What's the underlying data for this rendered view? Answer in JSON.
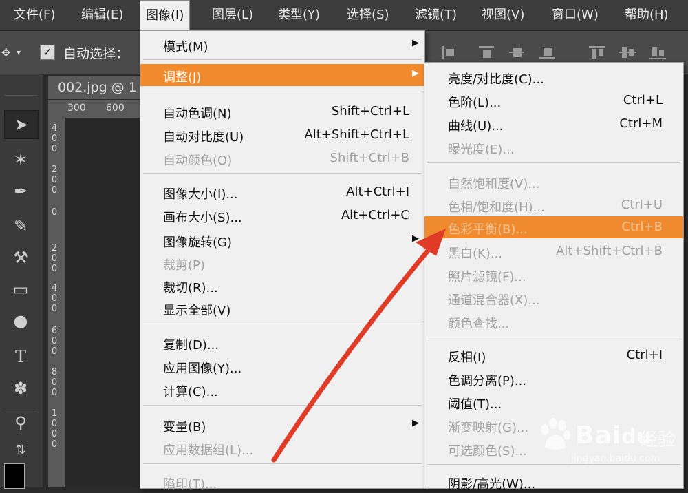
{
  "menubar": {
    "items": [
      "文件(F)",
      "编辑(E)",
      "图像(I)",
      "图层(L)",
      "类型(Y)",
      "选择(S)",
      "滤镜(T)",
      "视图(V)",
      "窗口(W)",
      "帮助(H)"
    ]
  },
  "options": {
    "auto_select_label": "自动选择："
  },
  "document": {
    "tab_title": "002.jpg @ 1",
    "ruler_h": [
      "300",
      "600"
    ],
    "ruler_v": [
      "4",
      "0",
      "0",
      "2",
      "0",
      "0",
      "0",
      "2",
      "0",
      "0",
      "4",
      "0",
      "0",
      "6",
      "0",
      "0",
      "8",
      "0",
      "0",
      "1",
      "0",
      "0",
      "0"
    ]
  },
  "image_menu": {
    "items": [
      {
        "label": "模式(M)",
        "shortcut": "",
        "submenu": true,
        "state": "normal"
      },
      {
        "label": "调整(J)",
        "shortcut": "",
        "submenu": true,
        "state": "highlight"
      },
      {
        "label": "自动色调(N)",
        "shortcut": "Shift+Ctrl+L",
        "submenu": false,
        "state": "normal"
      },
      {
        "label": "自动对比度(U)",
        "shortcut": "Alt+Shift+Ctrl+L",
        "submenu": false,
        "state": "normal"
      },
      {
        "label": "自动颜色(O)",
        "shortcut": "Shift+Ctrl+B",
        "submenu": false,
        "state": "disabled"
      },
      {
        "label": "图像大小(I)...",
        "shortcut": "Alt+Ctrl+I",
        "submenu": false,
        "state": "normal"
      },
      {
        "label": "画布大小(S)...",
        "shortcut": "Alt+Ctrl+C",
        "submenu": false,
        "state": "normal"
      },
      {
        "label": "图像旋转(G)",
        "shortcut": "",
        "submenu": true,
        "state": "normal"
      },
      {
        "label": "裁剪(P)",
        "shortcut": "",
        "submenu": false,
        "state": "disabled"
      },
      {
        "label": "裁切(R)...",
        "shortcut": "",
        "submenu": false,
        "state": "normal"
      },
      {
        "label": "显示全部(V)",
        "shortcut": "",
        "submenu": false,
        "state": "normal"
      },
      {
        "label": "复制(D)...",
        "shortcut": "",
        "submenu": false,
        "state": "normal"
      },
      {
        "label": "应用图像(Y)...",
        "shortcut": "",
        "submenu": false,
        "state": "normal"
      },
      {
        "label": "计算(C)...",
        "shortcut": "",
        "submenu": false,
        "state": "normal"
      },
      {
        "label": "变量(B)",
        "shortcut": "",
        "submenu": true,
        "state": "normal"
      },
      {
        "label": "应用数据组(L)...",
        "shortcut": "",
        "submenu": false,
        "state": "disabled"
      },
      {
        "label": "陷印(T)...",
        "shortcut": "",
        "submenu": false,
        "state": "disabled"
      }
    ]
  },
  "adjust_menu": {
    "items": [
      {
        "label": "亮度/对比度(C)...",
        "shortcut": "",
        "state": "normal"
      },
      {
        "label": "色阶(L)...",
        "shortcut": "Ctrl+L",
        "state": "normal"
      },
      {
        "label": "曲线(U)...",
        "shortcut": "Ctrl+M",
        "state": "normal"
      },
      {
        "label": "曝光度(E)...",
        "shortcut": "",
        "state": "disabled"
      },
      {
        "label": "自然饱和度(V)...",
        "shortcut": "",
        "state": "disabled"
      },
      {
        "label": "色相/饱和度(H)...",
        "shortcut": "Ctrl+U",
        "state": "disabled"
      },
      {
        "label": "色彩平衡(B)...",
        "shortcut": "Ctrl+B",
        "state": "highlight-dim"
      },
      {
        "label": "黑白(K)...",
        "shortcut": "Alt+Shift+Ctrl+B",
        "state": "disabled"
      },
      {
        "label": "照片滤镜(F)...",
        "shortcut": "",
        "state": "disabled"
      },
      {
        "label": "通道混合器(X)...",
        "shortcut": "",
        "state": "disabled"
      },
      {
        "label": "颜色查找...",
        "shortcut": "",
        "state": "disabled"
      },
      {
        "label": "反相(I)",
        "shortcut": "Ctrl+I",
        "state": "normal"
      },
      {
        "label": "色调分离(P)...",
        "shortcut": "",
        "state": "normal"
      },
      {
        "label": "阈值(T)...",
        "shortcut": "",
        "state": "normal"
      },
      {
        "label": "渐变映射(G)...",
        "shortcut": "",
        "state": "disabled"
      },
      {
        "label": "可选颜色(S)...",
        "shortcut": "",
        "state": "disabled"
      },
      {
        "label": "阴影/高光(W)...",
        "shortcut": "",
        "state": "normal"
      }
    ]
  },
  "watermark": {
    "brand": "Bai",
    "brand_suffix": "du",
    "text": "经验",
    "url": "jingyan.baidu.com"
  },
  "colors": {
    "highlight": "#f08a2c",
    "menu_bg": "#f0f0f0",
    "disabled_text": "#a3a3a3",
    "arrow": "#e03b27"
  },
  "icons": [
    "move-tool-icon",
    "magic-wand-icon",
    "eyedropper-icon",
    "brush-icon",
    "clone-stamp-icon",
    "gradient-icon",
    "dodge-icon",
    "type-tool-icon",
    "shape-tool-icon",
    "zoom-icon",
    "swap-colors-icon",
    "submenu-arrow-icon"
  ]
}
